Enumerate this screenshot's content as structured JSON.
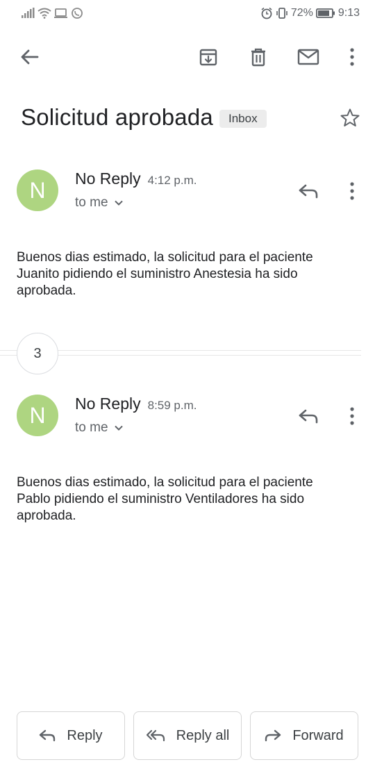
{
  "status_bar": {
    "battery_percent": "72%",
    "time": "9:13",
    "left_icons": [
      "signal-icon",
      "wifi-icon",
      "cast-icon",
      "whatsapp-icon"
    ],
    "right_icons": [
      "alarm-icon",
      "vibrate-icon",
      "battery-icon"
    ]
  },
  "toolbar": {
    "back": "back-arrow-icon",
    "archive": "archive-icon",
    "delete": "trash-icon",
    "mark_unread": "mail-icon",
    "more": "more-vert-icon"
  },
  "thread": {
    "subject": "Solicitud aprobada",
    "label": "Inbox",
    "star": "star-icon",
    "collapsed_count": "3"
  },
  "messages": [
    {
      "avatar_letter": "N",
      "avatar_color": "#aed581",
      "sender": "No Reply",
      "time": "4:12 p.m.",
      "recipient": "to me",
      "body": "Buenos dias estimado, la solicitud para el paciente Juanito pidiendo el suministro Anestesia ha sido aprobada."
    },
    {
      "avatar_letter": "N",
      "avatar_color": "#aed581",
      "sender": "No Reply",
      "time": "8:59 p.m.",
      "recipient": "to me",
      "body": "Buenos dias estimado, la solicitud para el paciente Pablo pidiendo el suministro Ventiladores ha sido aprobada."
    }
  ],
  "actions": {
    "reply": "Reply",
    "reply_all": "Reply all",
    "forward": "Forward"
  }
}
